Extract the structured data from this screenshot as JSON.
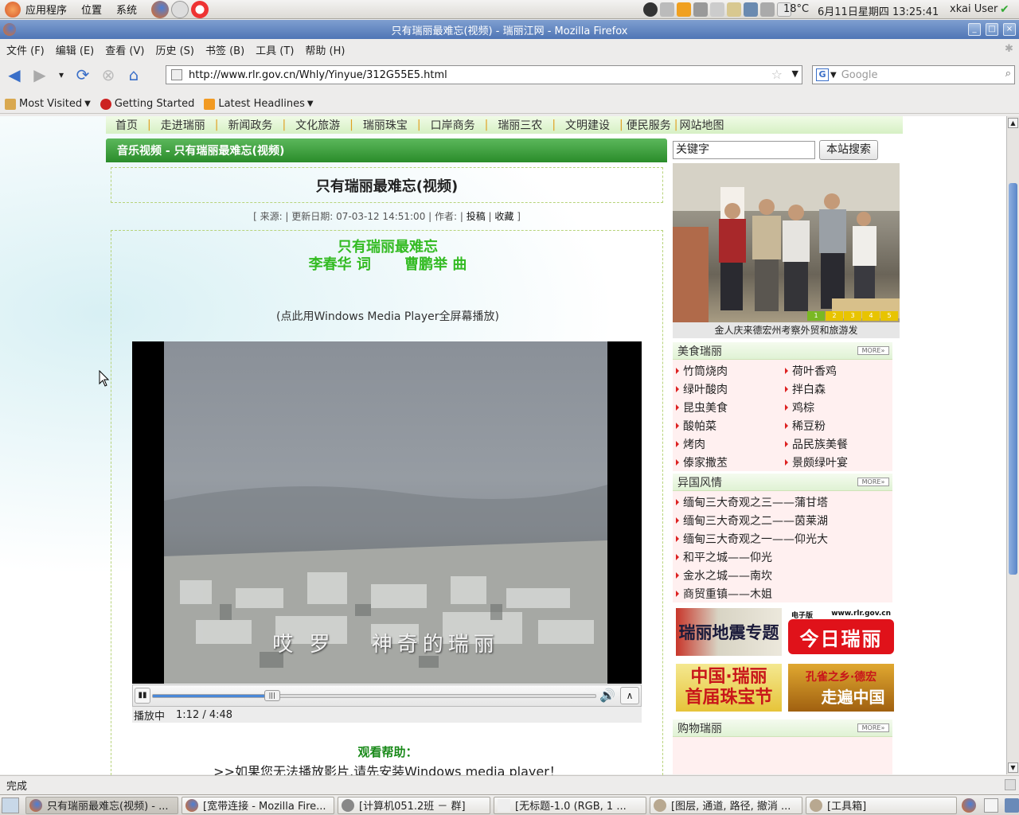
{
  "system_bar": {
    "menus": [
      "应用程序",
      "位置",
      "系统"
    ],
    "temperature": "18°C",
    "datetime": "6月11日星期四 13:25:41",
    "user": "xkai User"
  },
  "window": {
    "title": "只有瑞丽最难忘(视频) - 瑞丽江网 - Mozilla Firefox"
  },
  "menubar": {
    "items": [
      "文件 (F)",
      "编辑 (E)",
      "查看 (V)",
      "历史 (S)",
      "书签 (B)",
      "工具 (T)",
      "帮助 (H)"
    ]
  },
  "navbar": {
    "url": "http://www.rlr.gov.cn/Whly/Yinyue/312G55E5.html",
    "search_placeholder": "Google"
  },
  "bookmarks": [
    "Most Visited",
    "Getting Started",
    "Latest Headlines"
  ],
  "site_nav": [
    "首页",
    "走进瑞丽",
    "新闻政务",
    "文化旅游",
    "瑞丽珠宝",
    "口岸商务",
    "瑞丽三农",
    "文明建设",
    "便民服务",
    "网站地图"
  ],
  "section": {
    "breadcrumb": "音乐视频 - 只有瑞丽最难忘(视频)"
  },
  "article": {
    "title": "只有瑞丽最难忘(视频)",
    "meta_text": "[ 来源: | 更新日期: 07-03-12 14:51:00 | 作者: | ",
    "meta_link1": "投稿",
    "meta_link2": "收藏",
    "meta_end": " ]",
    "song_title": "只有瑞丽最难忘",
    "song_credits": "李春华 词 　　曹鹏举 曲",
    "fullscreen_hint": "(点此用Windows Media Player全屏幕播放)",
    "video_subtitle": "哎 罗 　神奇的瑞丽",
    "player_status": "播放中",
    "player_time": "1:12 / 4:48",
    "help_title": "观看帮助：",
    "help_line": ">>如果您无法播放影片,请先安装Windows media player！"
  },
  "player": {
    "progress": 0.27
  },
  "sidebar": {
    "search_placeholder": "关键字",
    "search_button": "本站搜索",
    "photo_caption": "金人庆来德宏州考察外贸和旅游发",
    "slide_numbers": [
      "1",
      "2",
      "3",
      "4",
      "5"
    ],
    "more_label": "MORE»",
    "food": {
      "title": "美食瑞丽",
      "left": [
        "竹筒烧肉",
        "绿叶酸肉",
        "昆虫美食",
        "酸帕菜",
        "烤肉",
        "傣家撒苤"
      ],
      "right": [
        "荷叶香鸡",
        "拌白森",
        "鸡棕",
        "稀豆粉",
        "品民族美餐",
        "景颇绿叶宴"
      ]
    },
    "foreign": {
      "title": "异国风情",
      "items": [
        "缅甸三大奇观之三——蒲甘塔",
        "缅甸三大奇观之二——茵莱湖",
        "缅甸三大奇观之一——仰光大",
        "和平之城——仰光",
        "金水之城——南坎",
        "商贸重镇——木姐"
      ]
    },
    "ads": {
      "ad1": "瑞丽地震专题",
      "ad2_top": "电子版",
      "ad2_url": "www.rlr.gov.cn",
      "ad2": "今日瑞丽",
      "ad3_line1": "中国·瑞丽",
      "ad3_line2": "首届珠宝节",
      "ad4_top": "孔雀之乡·德宏",
      "ad4": "走遍中国"
    },
    "shopping": {
      "title": "购物瑞丽"
    }
  },
  "statusbar": {
    "text": "完成"
  },
  "taskbar": {
    "tasks": [
      "只有瑞丽最难忘(视频) - ...",
      "[宽带连接 - Mozilla Fire...",
      "[计算机051.2班 － 群]",
      "[无标题-1.0 (RGB, 1 ...",
      "[图层, 通道, 路径, 撤消 ...",
      "[工具箱]"
    ]
  }
}
